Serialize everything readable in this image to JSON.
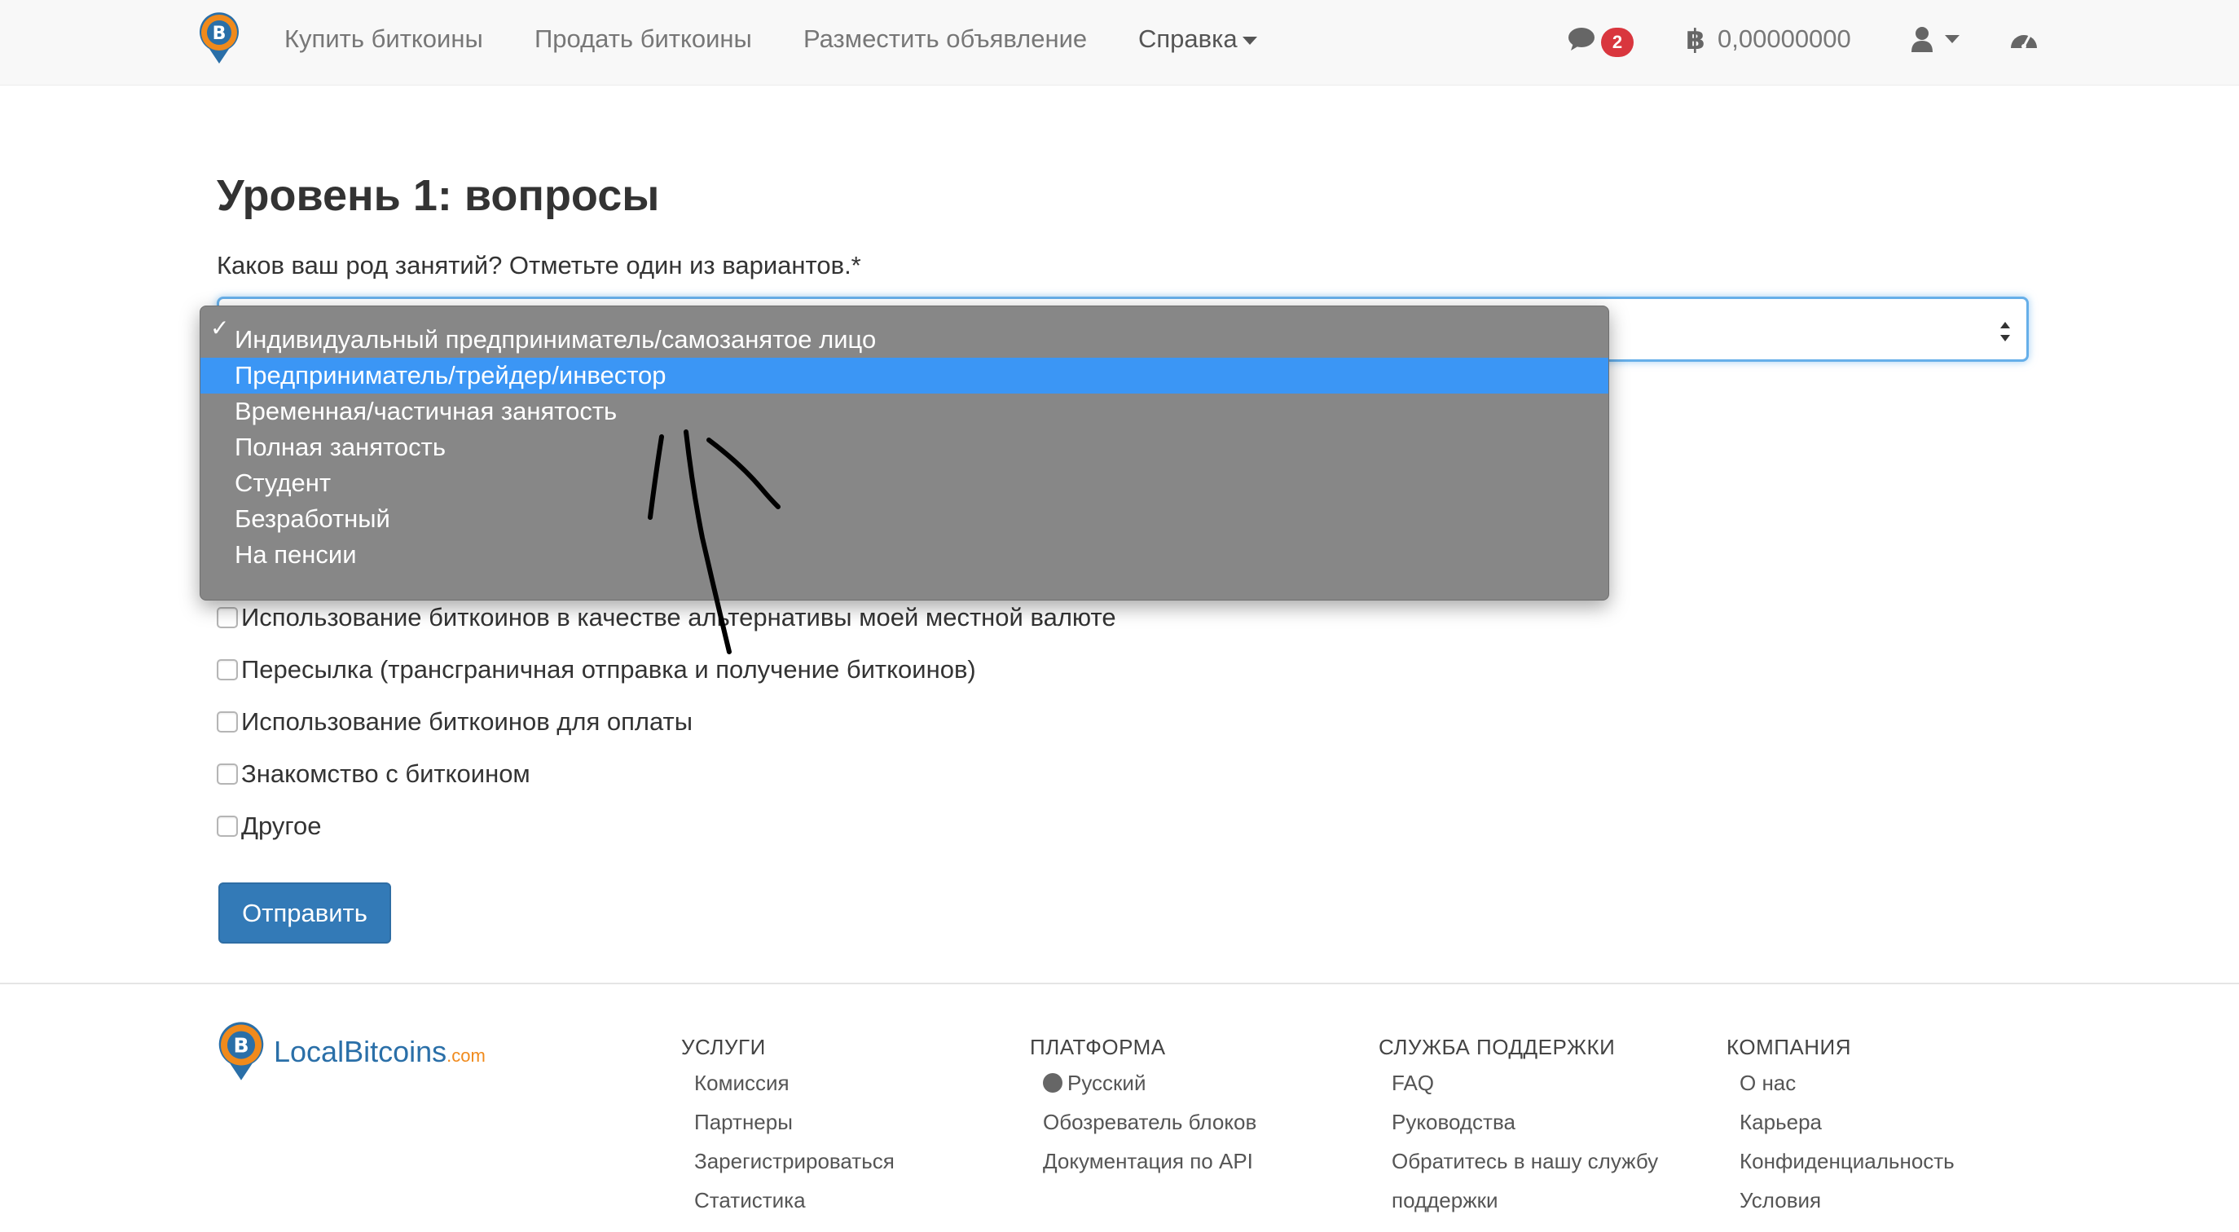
{
  "nav": {
    "links": [
      "Купить биткоины",
      "Продать биткоины",
      "Разместить объявление",
      "Справка"
    ],
    "messages_count": "2",
    "balance": "0,00000000",
    "logo_glyph": "B"
  },
  "main": {
    "title": "Уровень 1: вопросы",
    "question": "Каков ваш род занятий? Отметьте один из вариантов.*",
    "dropdown": {
      "check": "✓",
      "options": [
        "Индивидуальный предприниматель/самозанятое лицо",
        "Предприниматель/трейдер/инвестор",
        "Временная/частичная занятость",
        "Полная занятость",
        "Студент",
        "Безработный",
        "На пенсии"
      ],
      "highlighted_index": 1
    },
    "purposes": [
      "Использование биткоинов в качестве альтернативы моей местной валюте",
      "Пересылка (трансграничная отправка и получение биткоинов)",
      "Использование биткоинов для оплаты",
      "Знакомство с биткоином",
      "Другое"
    ],
    "submit_label": "Отправить"
  },
  "footer": {
    "logo_text": "LocalBitcoins",
    "logo_suffix": ".com",
    "columns": [
      {
        "heading": "УСЛУГИ",
        "links": [
          "Комиссия",
          "Партнеры",
          "Зарегистрироваться",
          "Статистика"
        ]
      },
      {
        "heading": "ПЛАТФОРМА",
        "links": [
          "Русский",
          "Обозреватель блоков",
          "Документация по API"
        ]
      },
      {
        "heading": "СЛУЖБА ПОДДЕРЖКИ",
        "links": [
          "FAQ",
          "Руководства",
          "Обратитесь в нашу службу",
          "поддержки"
        ]
      },
      {
        "heading": "КОМПАНИЯ",
        "links": [
          "О нас",
          "Карьера",
          "Конфиденциальность",
          "Условия"
        ]
      }
    ]
  },
  "colors": {
    "accent": "#337ab7",
    "highlight": "#3b96f5",
    "badge": "#d9363e",
    "logo_orange": "#f08a1c",
    "logo_blue": "#2a6fa8"
  }
}
